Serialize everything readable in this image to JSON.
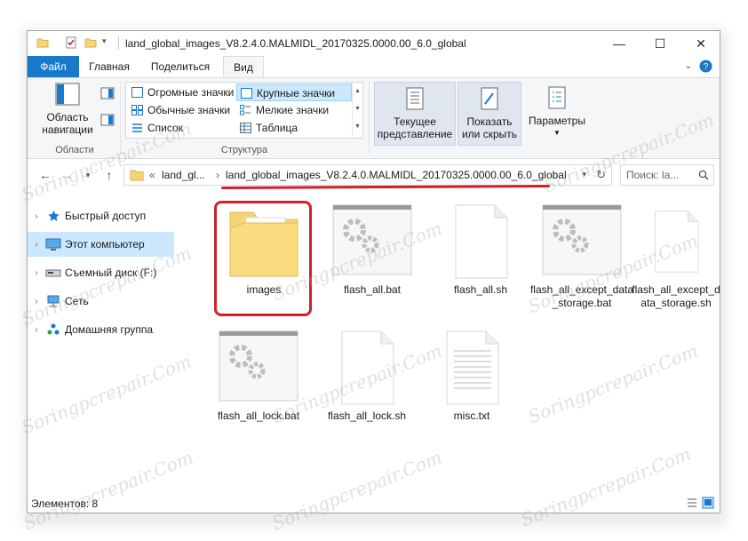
{
  "window": {
    "title": "land_global_images_V8.2.4.0.MALMIDL_20170325.0000.00_6.0_global",
    "controls": {
      "minimize": "—",
      "maximize": "☐",
      "close": "✕"
    }
  },
  "ribbon_tabs": [
    {
      "label": "Файл"
    },
    {
      "label": "Главная"
    },
    {
      "label": "Поделиться"
    },
    {
      "label": "Вид"
    }
  ],
  "ribbon": {
    "areas_group": {
      "nav_pane_label": "Область навигации",
      "nav_pane_line1": "Область",
      "nav_pane_line2": "навигации",
      "group_label": "Области"
    },
    "layout_group": {
      "items": [
        "Огромные значки",
        "Крупные значки",
        "Обычные значки",
        "Мелкие значки",
        "Список",
        "Таблица"
      ],
      "selected": "Крупные значки",
      "group_label": "Структура"
    },
    "current_view": {
      "line1": "Текущее",
      "line2": "представление"
    },
    "show_hide": {
      "line1": "Показать",
      "line2": "или скрыть"
    },
    "options": {
      "line1": "Параметры"
    }
  },
  "address": {
    "prefix": "«",
    "crumb_parent": "land_gl...",
    "separator": "›",
    "crumb_current": "land_global_images_V8.2.4.0.MALMIDL_20170325.0000.00_6.0_global",
    "search_placeholder": "Поиск: la..."
  },
  "nav_pane": {
    "items": [
      {
        "label": "Быстрый доступ",
        "icon": "star-icon"
      },
      {
        "label": "Этот компьютер",
        "icon": "computer-icon",
        "selected": true
      },
      {
        "label": "Съемный диск (F:)",
        "icon": "drive-icon"
      },
      {
        "label": "Сеть",
        "icon": "network-icon"
      },
      {
        "label": "Домашняя группа",
        "icon": "homegroup-icon"
      }
    ]
  },
  "files": [
    {
      "name": "images",
      "type": "folder"
    },
    {
      "name": "flash_all.bat",
      "type": "bat"
    },
    {
      "name": "flash_all.sh",
      "type": "doc"
    },
    {
      "name": "flash_all_except_data_storage.bat",
      "type": "bat"
    },
    {
      "name": "flash_all_except_data_storage.sh",
      "type": "doc"
    },
    {
      "name": "flash_all_lock.bat",
      "type": "bat"
    },
    {
      "name": "flash_all_lock.sh",
      "type": "doc"
    },
    {
      "name": "misc.txt",
      "type": "txt"
    }
  ],
  "status": {
    "items_count": "Элементов: 8"
  },
  "watermark": "Soringpcrepair.Com",
  "colors": {
    "accent": "#1979ca",
    "highlight": "#d0202a",
    "selection": "#cce8ff",
    "folder": "#f6d576"
  }
}
